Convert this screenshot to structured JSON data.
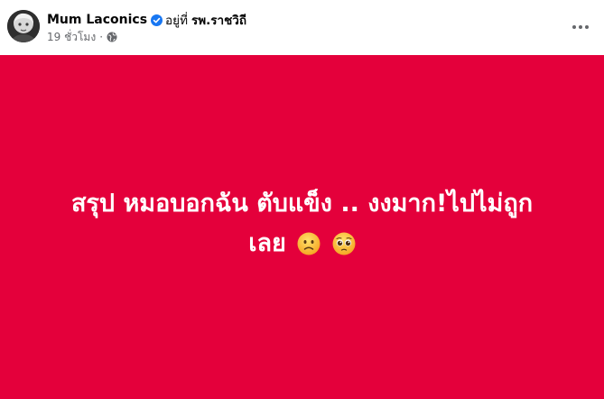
{
  "post": {
    "author_name": "Mum Laconics",
    "location_prefix": "อยู่ที่",
    "location_name": "รพ.ราชวิถี",
    "timestamp": "19 ชั่วโมง",
    "separator": "·",
    "privacy_icon": "globe-icon",
    "verified_icon": "verified-badge-icon",
    "more_icon": "more-options-icon",
    "body_text": "สรุป หมอบอกฉัน ตับแข็ง .. งงมาก!ไปไม่ถูก เลย",
    "emojis": [
      "slightly-frowning-face-emoji",
      "pleading-face-emoji"
    ],
    "background_color": "#e4003b"
  }
}
